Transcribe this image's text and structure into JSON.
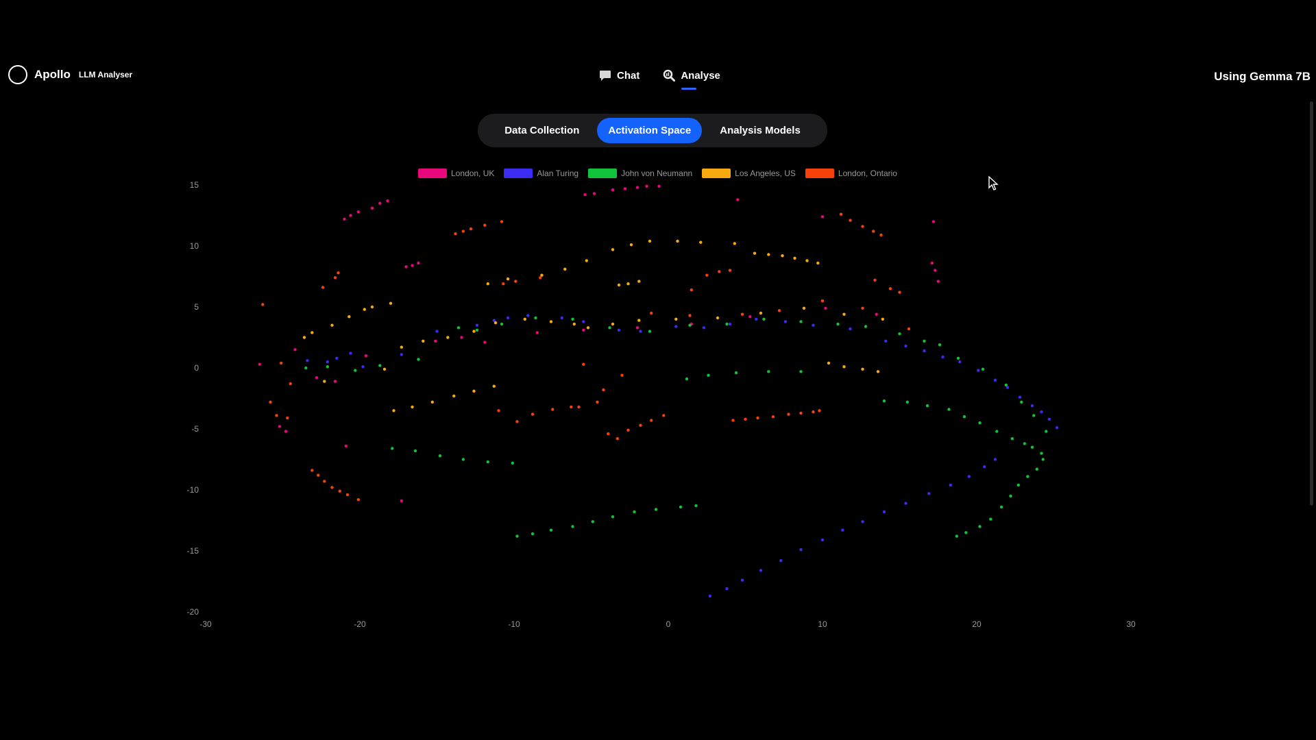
{
  "brand": {
    "name": "Apollo",
    "subtitle": "LLM Analyser"
  },
  "nav": [
    {
      "label": "Chat",
      "icon": "chat-bubble-icon"
    },
    {
      "label": "Analyse",
      "icon": "magnify-analyse-icon",
      "active": true
    }
  ],
  "model_label": "Using Gemma 7B",
  "tabs": [
    {
      "label": "Data Collection",
      "active": false
    },
    {
      "label": "Activation Space",
      "active": true
    },
    {
      "label": "Analysis Models",
      "active": false
    }
  ],
  "colors": {
    "accent": "#1463ff",
    "london_uk": "#e8087c",
    "alan_turing": "#3b2cf2",
    "john_von_neumann": "#11c23b",
    "los_angeles": "#f7aa10",
    "london_ontario": "#f6420a"
  },
  "chart_data": {
    "type": "scatter",
    "xlim": [
      -30,
      30
    ],
    "ylim": [
      -20,
      15
    ],
    "x_ticks": [
      -30,
      -20,
      -10,
      0,
      10,
      20,
      30
    ],
    "y_ticks": [
      15,
      10,
      5,
      0,
      -5,
      -10,
      -15,
      -20
    ],
    "grid": false,
    "legend_position": "top",
    "series": [
      {
        "name": "London, UK",
        "color": "#e8087c",
        "points": [
          [
            -21,
            12.2
          ],
          [
            -20.6,
            12.5
          ],
          [
            -20.1,
            12.8
          ],
          [
            -19.2,
            13.1
          ],
          [
            -18.7,
            13.5
          ],
          [
            -18.2,
            13.7
          ],
          [
            -17,
            8.3
          ],
          [
            -16.6,
            8.4
          ],
          [
            -16.2,
            8.6
          ],
          [
            -5.4,
            14.2
          ],
          [
            -4.8,
            14.3
          ],
          [
            -3.6,
            14.6
          ],
          [
            -2.8,
            14.7
          ],
          [
            -2,
            14.8
          ],
          [
            -1.4,
            14.9
          ],
          [
            -0.6,
            14.9
          ],
          [
            4.5,
            13.8
          ],
          [
            10,
            12.4
          ],
          [
            17.2,
            12
          ],
          [
            17.1,
            8.6
          ],
          [
            17.3,
            8
          ],
          [
            17.5,
            7.1
          ],
          [
            -26.5,
            0.3
          ],
          [
            -25.2,
            -4.8
          ],
          [
            -24.8,
            -5.2
          ],
          [
            -20.9,
            -6.4
          ],
          [
            -17.3,
            -10.9
          ],
          [
            -24.2,
            1.5
          ],
          [
            -22.8,
            -0.8
          ],
          [
            -21.6,
            -1.1
          ],
          [
            -19.6,
            1
          ],
          [
            -15.1,
            2.2
          ],
          [
            -13.4,
            2.5
          ],
          [
            -11.9,
            2.1
          ],
          [
            -8.5,
            2.9
          ],
          [
            -5.5,
            3.1
          ],
          [
            -2,
            3.3
          ],
          [
            1.5,
            3.6
          ],
          [
            5.3,
            4.2
          ],
          [
            10.2,
            4.9
          ],
          [
            13.5,
            4.4
          ]
        ]
      },
      {
        "name": "Alan Turing",
        "color": "#3b2cf2",
        "points": [
          [
            -23.4,
            0.6
          ],
          [
            -22.1,
            0.5
          ],
          [
            -21.5,
            0.8
          ],
          [
            -20.6,
            1.2
          ],
          [
            -19.8,
            0.1
          ],
          [
            -17.3,
            1.1
          ],
          [
            -15,
            3
          ],
          [
            -12.4,
            3.5
          ],
          [
            -11.3,
            3.9
          ],
          [
            -10.4,
            4.1
          ],
          [
            -9.1,
            4.3
          ],
          [
            -6.9,
            4.1
          ],
          [
            -5.5,
            3.8
          ],
          [
            -3.2,
            3.1
          ],
          [
            -1.8,
            3
          ],
          [
            0.5,
            3.4
          ],
          [
            2.3,
            3.3
          ],
          [
            4,
            3.6
          ],
          [
            5.7,
            4
          ],
          [
            7.6,
            3.8
          ],
          [
            9.4,
            3.5
          ],
          [
            11.8,
            3.2
          ],
          [
            14.1,
            2.2
          ],
          [
            15.4,
            1.8
          ],
          [
            16.6,
            1.4
          ],
          [
            17.8,
            0.9
          ],
          [
            18.9,
            0.5
          ],
          [
            20.1,
            -0.2
          ],
          [
            21.2,
            -1
          ],
          [
            22,
            -1.6
          ],
          [
            22.8,
            -2.4
          ],
          [
            23.6,
            -3.1
          ],
          [
            24.2,
            -3.6
          ],
          [
            24.7,
            -4.2
          ],
          [
            25.2,
            -4.9
          ],
          [
            21.2,
            -7.5
          ],
          [
            20.5,
            -8.1
          ],
          [
            19.5,
            -8.9
          ],
          [
            18.3,
            -9.6
          ],
          [
            16.9,
            -10.3
          ],
          [
            15.4,
            -11.1
          ],
          [
            14,
            -11.8
          ],
          [
            12.6,
            -12.6
          ],
          [
            11.3,
            -13.3
          ],
          [
            10,
            -14.1
          ],
          [
            8.6,
            -14.9
          ],
          [
            7.3,
            -15.8
          ],
          [
            6,
            -16.6
          ],
          [
            4.8,
            -17.4
          ],
          [
            3.8,
            -18.1
          ],
          [
            2.7,
            -18.7
          ]
        ]
      },
      {
        "name": "John von Neumann",
        "color": "#11c23b",
        "points": [
          [
            -23.5,
            0
          ],
          [
            -22.1,
            0.1
          ],
          [
            -20.3,
            -0.2
          ],
          [
            -18.7,
            0.2
          ],
          [
            -16.2,
            0.7
          ],
          [
            -13.6,
            3.3
          ],
          [
            -12.4,
            3.1
          ],
          [
            -10.8,
            3.6
          ],
          [
            -8.6,
            4.1
          ],
          [
            -6.2,
            4
          ],
          [
            -3.8,
            3.3
          ],
          [
            -1.2,
            3
          ],
          [
            1.4,
            3.5
          ],
          [
            3.8,
            3.6
          ],
          [
            6.2,
            4
          ],
          [
            8.6,
            3.8
          ],
          [
            11,
            3.6
          ],
          [
            12.8,
            3.4
          ],
          [
            15,
            2.8
          ],
          [
            16.6,
            2.2
          ],
          [
            17.6,
            1.9
          ],
          [
            18.8,
            0.8
          ],
          [
            20.4,
            -0.1
          ],
          [
            21.9,
            -1.4
          ],
          [
            22.9,
            -2.8
          ],
          [
            23.7,
            -3.9
          ],
          [
            24.5,
            -5.2
          ],
          [
            14,
            -2.7
          ],
          [
            15.5,
            -2.8
          ],
          [
            16.8,
            -3.1
          ],
          [
            18.2,
            -3.4
          ],
          [
            19.2,
            -4
          ],
          [
            20.2,
            -4.5
          ],
          [
            21.3,
            -5.2
          ],
          [
            22.3,
            -5.8
          ],
          [
            23.1,
            -6.2
          ],
          [
            23.6,
            -6.5
          ],
          [
            24.2,
            -7
          ],
          [
            24.3,
            -7.5
          ],
          [
            23.9,
            -8.3
          ],
          [
            23.3,
            -8.9
          ],
          [
            22.7,
            -9.6
          ],
          [
            22.2,
            -10.5
          ],
          [
            21.6,
            -11.4
          ],
          [
            20.9,
            -12.4
          ],
          [
            20.2,
            -13
          ],
          [
            19.3,
            -13.5
          ],
          [
            18.7,
            -13.8
          ],
          [
            1.2,
            -0.9
          ],
          [
            2.6,
            -0.6
          ],
          [
            4.4,
            -0.4
          ],
          [
            6.5,
            -0.3
          ],
          [
            8.6,
            -0.3
          ],
          [
            -17.9,
            -6.6
          ],
          [
            -16.4,
            -6.8
          ],
          [
            -14.8,
            -7.2
          ],
          [
            -13.3,
            -7.5
          ],
          [
            -11.7,
            -7.7
          ],
          [
            -10.1,
            -7.8
          ],
          [
            -9.8,
            -13.8
          ],
          [
            -8.8,
            -13.6
          ],
          [
            -7.6,
            -13.3
          ],
          [
            -6.2,
            -13
          ],
          [
            -4.9,
            -12.6
          ],
          [
            -3.6,
            -12.2
          ],
          [
            -2.2,
            -11.8
          ],
          [
            -0.8,
            -11.6
          ],
          [
            0.8,
            -11.4
          ],
          [
            1.8,
            -11.3
          ]
        ]
      },
      {
        "name": "Los Angeles, US",
        "color": "#f7aa10",
        "points": [
          [
            -23.6,
            2.5
          ],
          [
            -23.1,
            2.9
          ],
          [
            -21.8,
            3.5
          ],
          [
            -20.7,
            4.2
          ],
          [
            -19.7,
            4.8
          ],
          [
            -19.2,
            5
          ],
          [
            -18,
            5.3
          ],
          [
            -22.3,
            -1.1
          ],
          [
            -18.4,
            -0.1
          ],
          [
            -17.3,
            1.7
          ],
          [
            -15.9,
            2.2
          ],
          [
            -14.3,
            2.5
          ],
          [
            -12.6,
            3
          ],
          [
            -11.2,
            3.7
          ],
          [
            -9.3,
            4
          ],
          [
            -7.6,
            3.8
          ],
          [
            -6.1,
            3.6
          ],
          [
            -11.7,
            6.9
          ],
          [
            -10.4,
            7.3
          ],
          [
            -8.2,
            7.6
          ],
          [
            -6.7,
            8.1
          ],
          [
            -5.3,
            8.8
          ],
          [
            -3.6,
            9.7
          ],
          [
            -2.4,
            10.1
          ],
          [
            -1.2,
            10.4
          ],
          [
            0.6,
            10.4
          ],
          [
            2.1,
            10.3
          ],
          [
            4.3,
            10.2
          ],
          [
            -1.9,
            7.1
          ],
          [
            -2.6,
            6.9
          ],
          [
            -3.2,
            6.8
          ],
          [
            5.6,
            9.4
          ],
          [
            6.5,
            9.3
          ],
          [
            7.4,
            9.2
          ],
          [
            8.2,
            9
          ],
          [
            9,
            8.8
          ],
          [
            9.7,
            8.6
          ],
          [
            -17.8,
            -3.5
          ],
          [
            -16.6,
            -3.2
          ],
          [
            -15.3,
            -2.8
          ],
          [
            -13.9,
            -2.3
          ],
          [
            -12.6,
            -1.9
          ],
          [
            -11.3,
            -1.5
          ],
          [
            -5.2,
            3.3
          ],
          [
            -3.6,
            3.6
          ],
          [
            -1.9,
            3.9
          ],
          [
            0.5,
            4
          ],
          [
            3.2,
            4.1
          ],
          [
            6,
            4.5
          ],
          [
            8.8,
            4.9
          ],
          [
            11.4,
            4.4
          ],
          [
            13.9,
            4
          ],
          [
            10.4,
            0.4
          ],
          [
            11.4,
            0.1
          ],
          [
            12.6,
            -0.1
          ],
          [
            13.6,
            -0.3
          ]
        ]
      },
      {
        "name": "London, Ontario",
        "color": "#f6420a",
        "points": [
          [
            -26.3,
            5.2
          ],
          [
            -25.1,
            0.4
          ],
          [
            -24.5,
            -1.3
          ],
          [
            -25.8,
            -2.8
          ],
          [
            -25.4,
            -3.9
          ],
          [
            -24.7,
            -4.1
          ],
          [
            -23.1,
            -8.4
          ],
          [
            -22.7,
            -8.8
          ],
          [
            -22.3,
            -9.3
          ],
          [
            -21.8,
            -9.8
          ],
          [
            -21.3,
            -10.1
          ],
          [
            -20.8,
            -10.4
          ],
          [
            -20.1,
            -10.8
          ],
          [
            -22.4,
            6.6
          ],
          [
            -21.6,
            7.4
          ],
          [
            -21.4,
            7.8
          ],
          [
            -13.8,
            11
          ],
          [
            -13.3,
            11.2
          ],
          [
            -12.8,
            11.4
          ],
          [
            -11.9,
            11.7
          ],
          [
            -10.8,
            12
          ],
          [
            -10.7,
            6.9
          ],
          [
            -9.9,
            7.1
          ],
          [
            -8.3,
            7.4
          ],
          [
            -5.5,
            0.3
          ],
          [
            -3,
            -0.6
          ],
          [
            -4.2,
            -1.8
          ],
          [
            -11,
            -3.5
          ],
          [
            -9.8,
            -4.4
          ],
          [
            -8.8,
            -3.8
          ],
          [
            -7.5,
            -3.4
          ],
          [
            -6.3,
            -3.2
          ],
          [
            -5.8,
            -3.2
          ],
          [
            -4.6,
            -2.8
          ],
          [
            -3.9,
            -5.4
          ],
          [
            -3.3,
            -5.8
          ],
          [
            -2.6,
            -5.1
          ],
          [
            -1.8,
            -4.7
          ],
          [
            -1.1,
            -4.3
          ],
          [
            -0.3,
            -3.9
          ],
          [
            4.2,
            -4.3
          ],
          [
            5,
            -4.2
          ],
          [
            5.8,
            -4.1
          ],
          [
            6.8,
            -4
          ],
          [
            7.8,
            -3.8
          ],
          [
            8.6,
            -3.7
          ],
          [
            9.4,
            -3.6
          ],
          [
            9.8,
            -3.5
          ],
          [
            11.2,
            12.6
          ],
          [
            11.8,
            12.1
          ],
          [
            12.6,
            11.6
          ],
          [
            13.3,
            11.2
          ],
          [
            13.8,
            10.9
          ],
          [
            13.4,
            7.2
          ],
          [
            14.4,
            6.5
          ],
          [
            15,
            6.2
          ],
          [
            2.5,
            7.6
          ],
          [
            3.3,
            7.9
          ],
          [
            4,
            8
          ],
          [
            1.5,
            6.4
          ],
          [
            -1.1,
            4.5
          ],
          [
            1.4,
            4.3
          ],
          [
            4.8,
            4.4
          ],
          [
            7.2,
            4.7
          ],
          [
            10,
            5.5
          ],
          [
            12.6,
            4.9
          ],
          [
            15.6,
            3.2
          ]
        ]
      }
    ]
  }
}
